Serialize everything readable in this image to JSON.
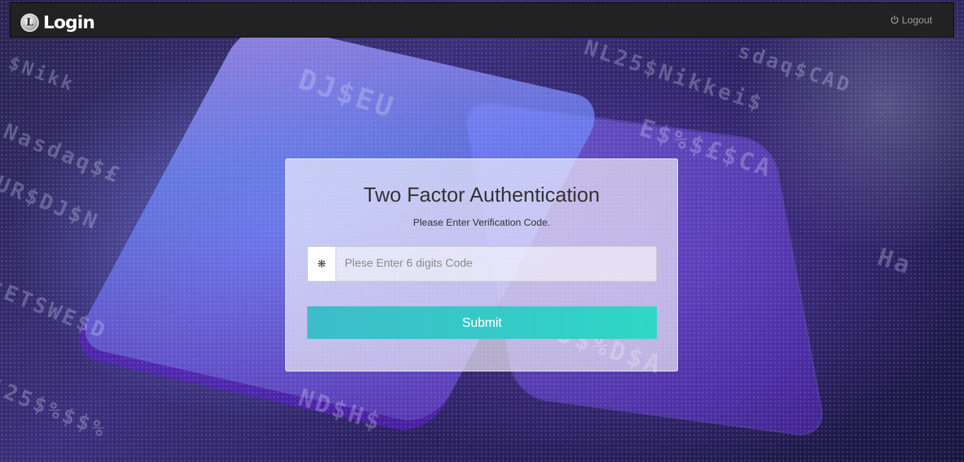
{
  "navbar": {
    "brand_icon_letter": "L",
    "brand_text": "Login",
    "logout_label": "Logout",
    "logout_icon": "power-icon"
  },
  "auth_panel": {
    "title": "Two Factor Authentication",
    "subtitle": "Please Enter Verification Code.",
    "input_icon": "asterisk-icon",
    "input_icon_glyph": "❋",
    "code_input": {
      "value": "",
      "placeholder": "Plese Enter 6 digits Code"
    },
    "submit_label": "Submit"
  },
  "colors": {
    "navbar_bg": "#222222",
    "submit_start": "#3dbdca",
    "submit_end": "#2fd7c6",
    "panel_bg": "rgba(255,255,255,0.62)"
  }
}
